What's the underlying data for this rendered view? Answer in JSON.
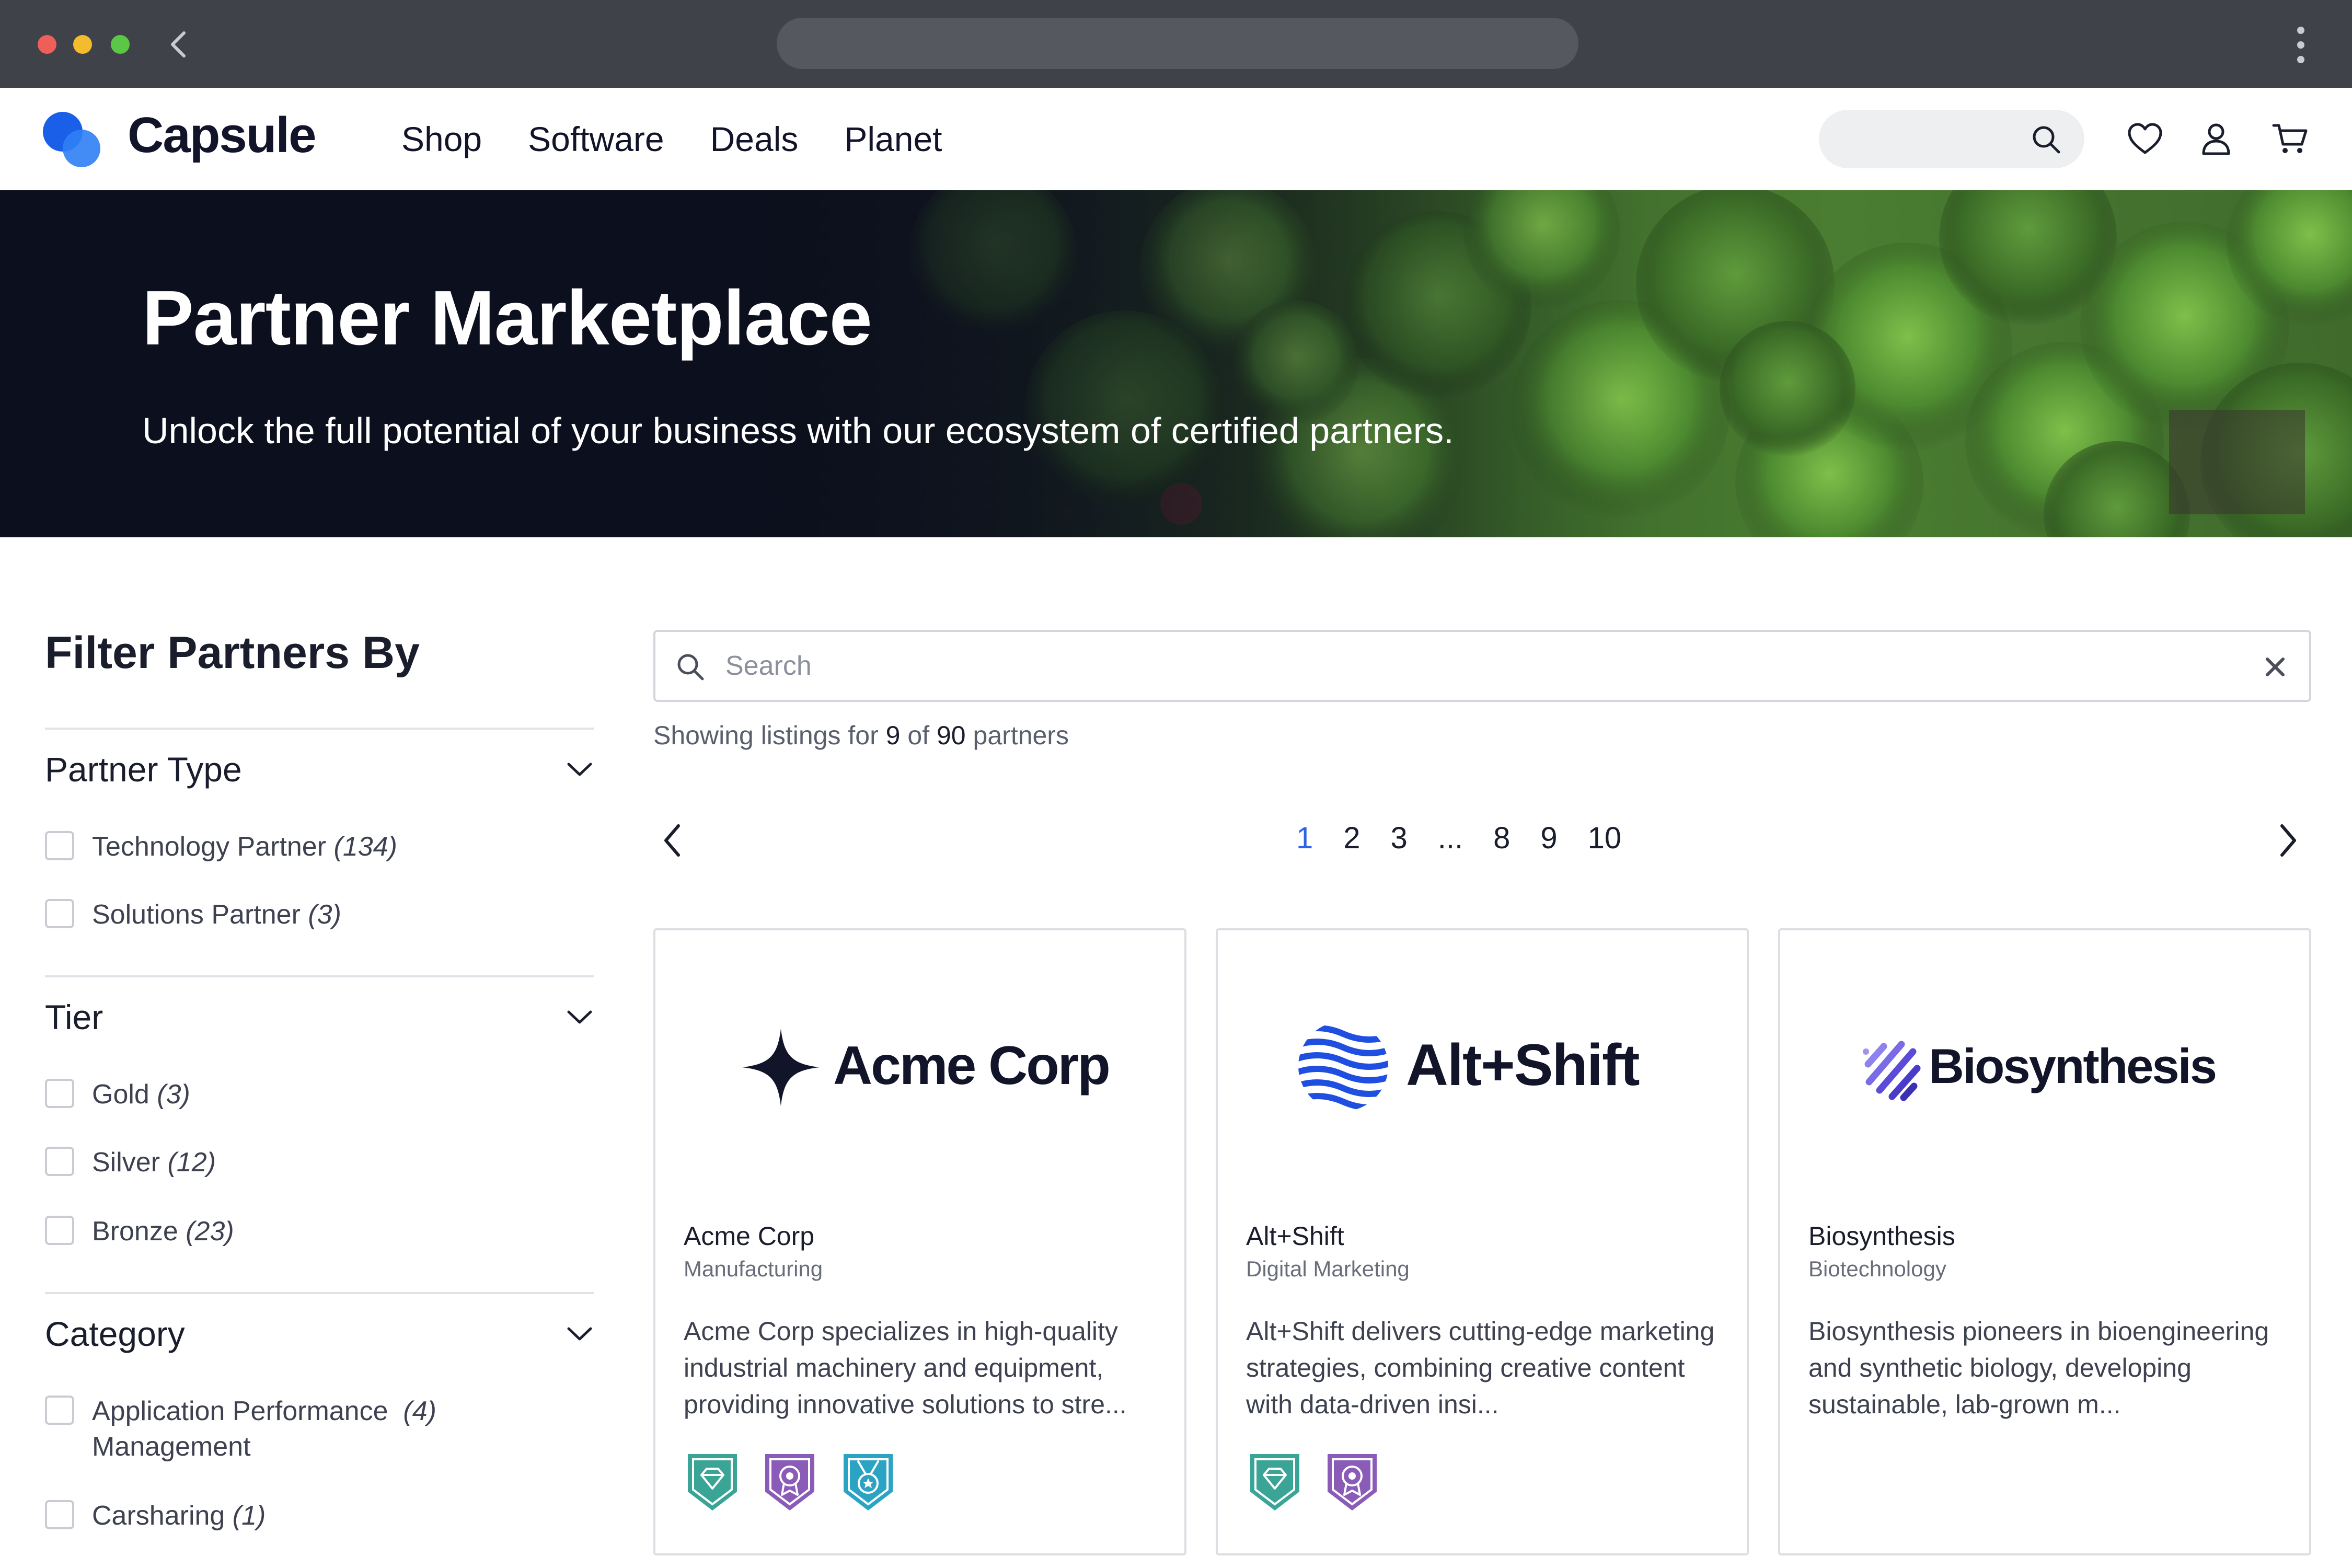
{
  "nav": {
    "brand": "Capsule",
    "links": [
      "Shop",
      "Software",
      "Deals",
      "Planet"
    ]
  },
  "hero": {
    "title": "Partner Marketplace",
    "subtitle": "Unlock the full potential of your business with our ecosystem of certified partners."
  },
  "sidebar": {
    "title": "Filter Partners By",
    "sections": [
      {
        "label": "Partner Type",
        "options": [
          {
            "label": "Technology Partner",
            "count": "(134)"
          },
          {
            "label": "Solutions Partner",
            "count": "(3)"
          }
        ]
      },
      {
        "label": "Tier",
        "options": [
          {
            "label": "Gold",
            "count": "(3)"
          },
          {
            "label": "Silver",
            "count": "(12)"
          },
          {
            "label": "Bronze",
            "count": "(23)"
          }
        ]
      },
      {
        "label": "Category",
        "options": [
          {
            "label": "Application Performance",
            "label2": "Management",
            "count": "(4)"
          },
          {
            "label": "Carsharing",
            "count": "(1)"
          }
        ]
      }
    ]
  },
  "search": {
    "placeholder": "Search",
    "value": ""
  },
  "results": {
    "prefix": "Showing listings for",
    "shown": "9",
    "of_word": "of",
    "total": "90",
    "suffix": "partners"
  },
  "pagination": {
    "pages": [
      "1",
      "2",
      "3",
      "...",
      "8",
      "9",
      "10"
    ],
    "current": "1"
  },
  "cards": [
    {
      "logo_text": "Acme Corp",
      "name": "Acme Corp",
      "industry": "Manufacturing",
      "description": "Acme Corp specializes in high-quality industrial machinery and equipment, providing innovative solutions to stre...",
      "badges": [
        "gem-badge-icon",
        "award-badge-icon",
        "medal-badge-icon"
      ]
    },
    {
      "logo_text": "Alt+Shift",
      "name": "Alt+Shift",
      "industry": "Digital Marketing",
      "description": "Alt+Shift delivers cutting-edge marketing strategies, combining creative content with data-driven insi...",
      "badges": [
        "gem-badge-icon",
        "award-badge-icon"
      ]
    },
    {
      "logo_text": "Biosynthesis",
      "name": "Biosynthesis",
      "industry": "Biotechnology",
      "description": "Biosynthesis pioneers in bioengineering and synthetic biology, developing sustainable, lab-grown m...",
      "badges": []
    }
  ],
  "colors": {
    "brand_blue": "#1f5be3",
    "active_page": "#2c62e8",
    "badge_teal": "#3aa596",
    "badge_purple": "#8a5cb8",
    "badge_cyan": "#2ba4c4",
    "altshift_blue": "#1f4fe0",
    "biosynthesis_purple": "#5b4bd6"
  }
}
